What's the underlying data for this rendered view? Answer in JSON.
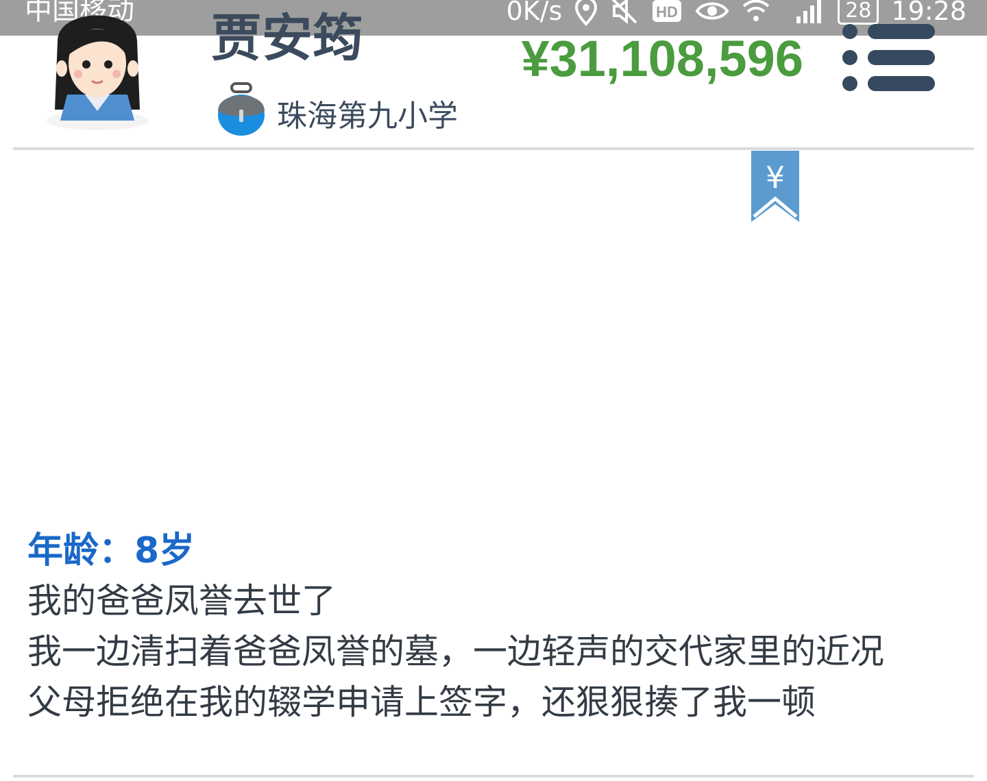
{
  "status_bar": {
    "carrier": "中国移动",
    "speed": "0K/s",
    "battery": "28",
    "time": "19:28",
    "icons": [
      "sim-icon",
      "location-icon",
      "mute-icon",
      "hd-icon",
      "eye-icon",
      "wifi-icon",
      "signal-icon",
      "battery-icon"
    ]
  },
  "profile": {
    "name": "贾安筠",
    "school": "珠海第九小学",
    "balance": "¥31,108,596",
    "avatar_icon": "girl-avatar-icon",
    "school_icon": "school-bag-icon"
  },
  "menu": {
    "icon": "list-menu-icon"
  },
  "badge": {
    "icon": "yuan-bookmark-icon",
    "symbol": "¥"
  },
  "details": {
    "age": "年龄：8岁",
    "lines": [
      "我的爸爸凤誉去世了",
      "我一边清扫着爸爸凤誉的墓，一边轻声的交代家里的近况",
      "父母拒绝在我的辍学申请上签字，还狠狠揍了我一顿"
    ]
  },
  "colors": {
    "status_bar": "#9e9e9e",
    "text_dark": "#3b4a5c",
    "balance_green": "#4b9b3f",
    "age_blue": "#1a68c9",
    "bookmark_blue": "#5b9bd0",
    "divider": "#dcdcdc"
  }
}
